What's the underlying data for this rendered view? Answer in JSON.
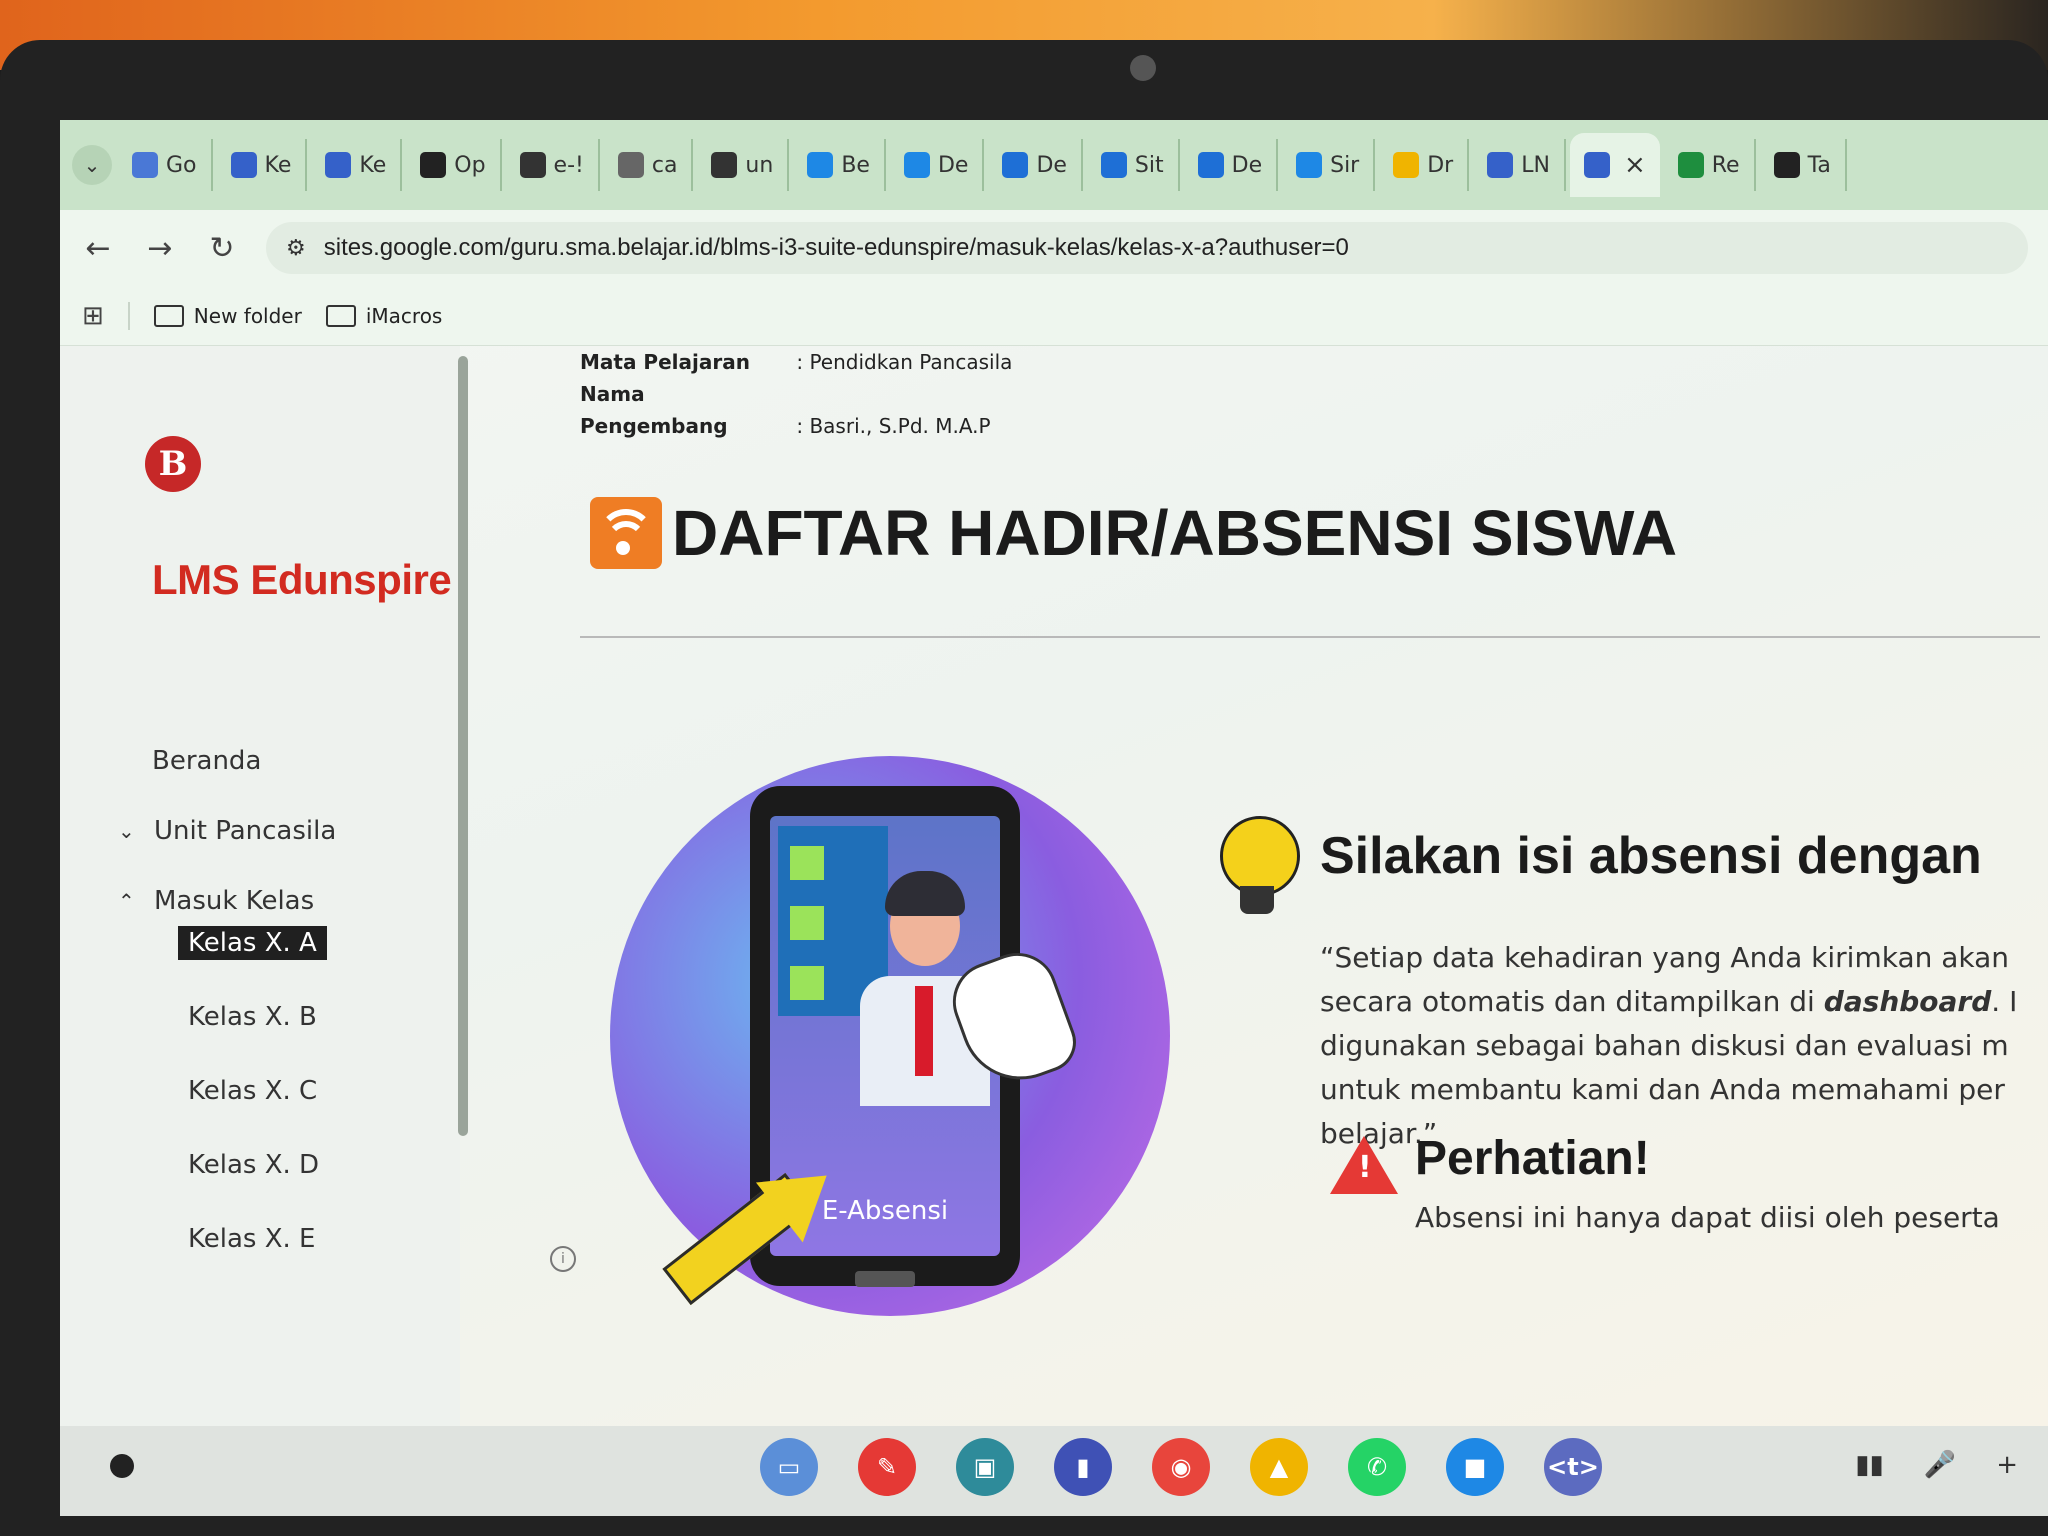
{
  "colors": {
    "brand_red": "#d22b20",
    "accent_orange": "#ef7d24",
    "tab_strip": "#c9e3c9",
    "active_nav_bg": "#202020"
  },
  "browser": {
    "tabs": [
      {
        "label": "Go",
        "icon": "gemini-icon",
        "color": "#4a78d6"
      },
      {
        "label": "Ke",
        "icon": "sheets-icon",
        "color": "#3561c9"
      },
      {
        "label": "Ke",
        "icon": "sheets-icon",
        "color": "#3561c9"
      },
      {
        "label": "Op",
        "icon": "openai-icon",
        "color": "#222222"
      },
      {
        "label": "e-!",
        "icon": "globe-icon",
        "color": "#333333"
      },
      {
        "label": "ca",
        "icon": "google-icon",
        "color": "#666666"
      },
      {
        "label": "un",
        "icon": "github-icon",
        "color": "#333333"
      },
      {
        "label": "Be",
        "icon": "canva-icon",
        "color": "#1e88e5"
      },
      {
        "label": "De",
        "icon": "canva-icon",
        "color": "#1e88e5"
      },
      {
        "label": "De",
        "icon": "calendar-icon",
        "color": "#1e6fd6"
      },
      {
        "label": "Sit",
        "icon": "calendar-icon",
        "color": "#1e6fd6"
      },
      {
        "label": "De",
        "icon": "calendar-icon",
        "color": "#1e6fd6"
      },
      {
        "label": "Sir",
        "icon": "canva-icon",
        "color": "#1e88e5"
      },
      {
        "label": "Dr",
        "icon": "drive-icon",
        "color": "#f0b400"
      },
      {
        "label": "LN",
        "icon": "sites-icon",
        "color": "#3561c9"
      },
      {
        "label": "",
        "icon": "sites-icon",
        "color": "#3561c9",
        "active": true
      },
      {
        "label": "Re",
        "icon": "classroom-icon",
        "color": "#1e8e3e"
      },
      {
        "label": "Ta",
        "icon": "openai-icon",
        "color": "#222222"
      }
    ],
    "tab_close": "×",
    "url": "sites.google.com/guru.sma.belajar.id/blms-i3-suite-edunspire/masuk-kelas/kelas-x-a?authuser=0",
    "nav": {
      "back": "←",
      "forward": "→",
      "reload": "↻",
      "tune": "⚙"
    },
    "bookmarks": [
      {
        "label": "New folder",
        "icon": "folder-icon"
      },
      {
        "label": "iMacros",
        "icon": "folder-icon"
      }
    ]
  },
  "sidebar": {
    "logo_letter": "B",
    "site_title": "LMS Edunspire",
    "items": [
      {
        "label": "Beranda",
        "chevron": ""
      },
      {
        "label": "Unit Pancasila",
        "chevron": "⌄"
      },
      {
        "label": "Masuk Kelas",
        "chevron": "⌃"
      }
    ],
    "sub_items": [
      {
        "label": "Kelas X. A",
        "active": true
      },
      {
        "label": "Kelas X. B"
      },
      {
        "label": "Kelas X. C"
      },
      {
        "label": "Kelas X. D"
      },
      {
        "label": "Kelas X. E"
      }
    ],
    "info_glyph": "i"
  },
  "main": {
    "meta": [
      {
        "key": "Mata Pelajaran",
        "value": ": Pendidkan Pancasila"
      },
      {
        "key": "Nama Pengembang",
        "value": ": Basri., S.Pd. M.A.P"
      }
    ],
    "heading": "DAFTAR HADIR/ABSENSI SISWA",
    "illustration_label": "E-Absensi",
    "sub_heading": "Silakan isi absensi dengan",
    "quote_lines": [
      "“Setiap data kehadiran yang Anda kirimkan akan",
      "secara otomatis dan ditampilkan di ",
      "digunakan sebagai bahan diskusi dan evaluasi m",
      "untuk membantu kami dan Anda memahami per",
      "belajar.”"
    ],
    "quote_bold": "dashboard",
    "quote_bold_suffix": ". I",
    "warning_heading": "Perhatian!",
    "warning_text": "Absensi ini hanya dapat diisi oleh peserta"
  },
  "shelf": {
    "apps": [
      {
        "name": "files-doc-app",
        "color": "#5b8fd8",
        "glyph": "▭"
      },
      {
        "name": "paint-app",
        "color": "#e53935",
        "glyph": "✎"
      },
      {
        "name": "meet-app",
        "color": "#2e8b9a",
        "glyph": "▣"
      },
      {
        "name": "book-app",
        "color": "#3f51b5",
        "glyph": "▮"
      },
      {
        "name": "chrome-app",
        "color": "#e8453c",
        "glyph": "◉"
      },
      {
        "name": "drive-app",
        "color": "#f0b400",
        "glyph": "▲"
      },
      {
        "name": "whatsapp-app",
        "color": "#25d366",
        "glyph": "✆"
      },
      {
        "name": "files-app",
        "color": "#1e88e5",
        "glyph": "■"
      },
      {
        "name": "terminal-app",
        "color": "#5c6bc0",
        "glyph": "<t>"
      }
    ],
    "tray": [
      "▮▮",
      "🎤",
      "+"
    ]
  }
}
